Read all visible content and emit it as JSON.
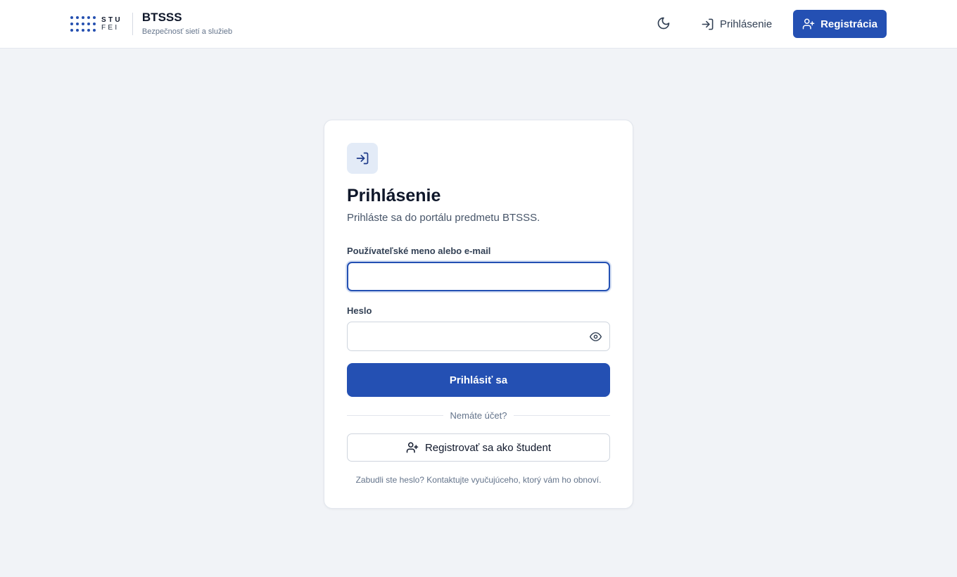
{
  "header": {
    "logo_top": "STU",
    "logo_bottom": "FEI",
    "title": "BTSSS",
    "subtitle": "Bezpečnosť sietí a služieb",
    "theme_icon": "moon-icon",
    "login_label": "Prihlásenie",
    "register_label": "Registrácia"
  },
  "card": {
    "icon": "login-arrow-icon",
    "title": "Prihlásenie",
    "subtitle": "Prihláste sa do portálu predmetu BTSSS.",
    "username_label": "Používateľské meno alebo e-mail",
    "username_value": "",
    "password_label": "Heslo",
    "password_value": "",
    "password_toggle_icon": "eye-icon",
    "submit_label": "Prihlásiť sa",
    "divider_text": "Nemáte účet?",
    "student_register_label": "Registrovať sa ako študent",
    "forgot_text": "Zabudli ste heslo? Kontaktujte vyučujúceho, ktorý vám ho obnoví."
  },
  "colors": {
    "accent": "#2450b3",
    "background": "#f1f3f7",
    "card": "#ffffff",
    "icon_bg": "#e3ebf7"
  }
}
